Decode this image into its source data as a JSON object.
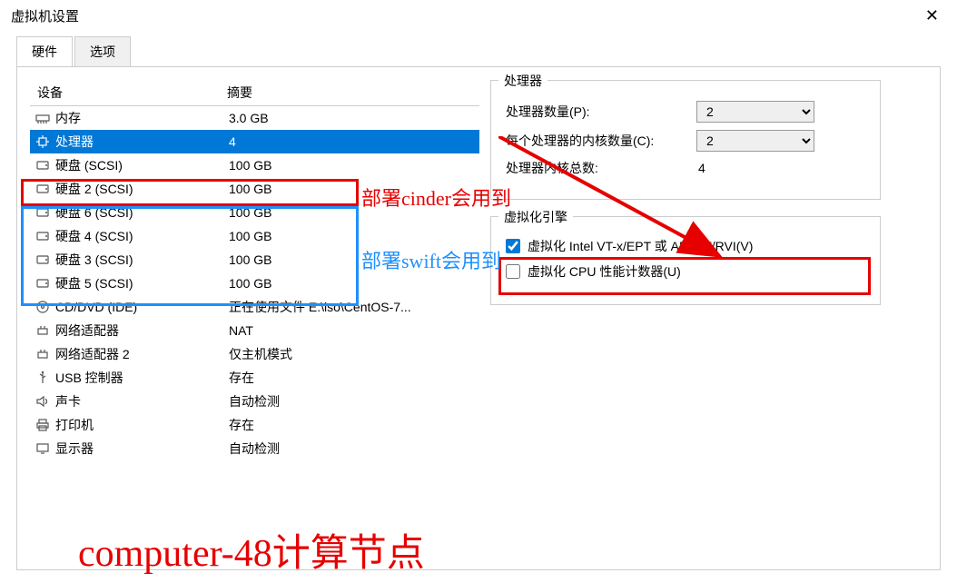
{
  "window": {
    "title": "虚拟机设置"
  },
  "tabs": {
    "hardware": "硬件",
    "options": "选项"
  },
  "table": {
    "head_device": "设备",
    "head_summary": "摘要"
  },
  "devices": [
    {
      "icon": "memory-icon",
      "name": "内存",
      "summary": "3.0 GB"
    },
    {
      "icon": "cpu-icon",
      "name": "处理器",
      "summary": "4"
    },
    {
      "icon": "disk-icon",
      "name": "硬盘 (SCSI)",
      "summary": "100 GB"
    },
    {
      "icon": "disk-icon",
      "name": "硬盘 2 (SCSI)",
      "summary": "100 GB"
    },
    {
      "icon": "disk-icon",
      "name": "硬盘 6 (SCSI)",
      "summary": "100 GB"
    },
    {
      "icon": "disk-icon",
      "name": "硬盘 4 (SCSI)",
      "summary": "100 GB"
    },
    {
      "icon": "disk-icon",
      "name": "硬盘 3 (SCSI)",
      "summary": "100 GB"
    },
    {
      "icon": "disk-icon",
      "name": "硬盘 5 (SCSI)",
      "summary": "100 GB"
    },
    {
      "icon": "cd-icon",
      "name": "CD/DVD (IDE)",
      "summary": "正在使用文件 E:\\iso\\CentOS-7..."
    },
    {
      "icon": "net-icon",
      "name": "网络适配器",
      "summary": "NAT"
    },
    {
      "icon": "net-icon",
      "name": "网络适配器 2",
      "summary": "仅主机模式"
    },
    {
      "icon": "usb-icon",
      "name": "USB 控制器",
      "summary": "存在"
    },
    {
      "icon": "sound-icon",
      "name": "声卡",
      "summary": "自动检测"
    },
    {
      "icon": "printer-icon",
      "name": "打印机",
      "summary": "存在"
    },
    {
      "icon": "display-icon",
      "name": "显示器",
      "summary": "自动检测"
    }
  ],
  "proc_group": {
    "title": "处理器",
    "processors_label": "处理器数量(P):",
    "processors_value": "2",
    "cores_label": "每个处理器的内核数量(C):",
    "cores_value": "2",
    "total_label": "处理器内核总数:",
    "total_value": "4"
  },
  "virt_group": {
    "title": "虚拟化引擎",
    "vtx_label": "虚拟化 Intel VT-x/EPT 或 AMD-V/RVI(V)",
    "cpu_perf_label": "虚拟化 CPU 性能计数器(U)"
  },
  "annotations": {
    "cinder": "部署cinder会用到",
    "swift": "部署swift会用到",
    "node": "computer-48计算节点"
  }
}
